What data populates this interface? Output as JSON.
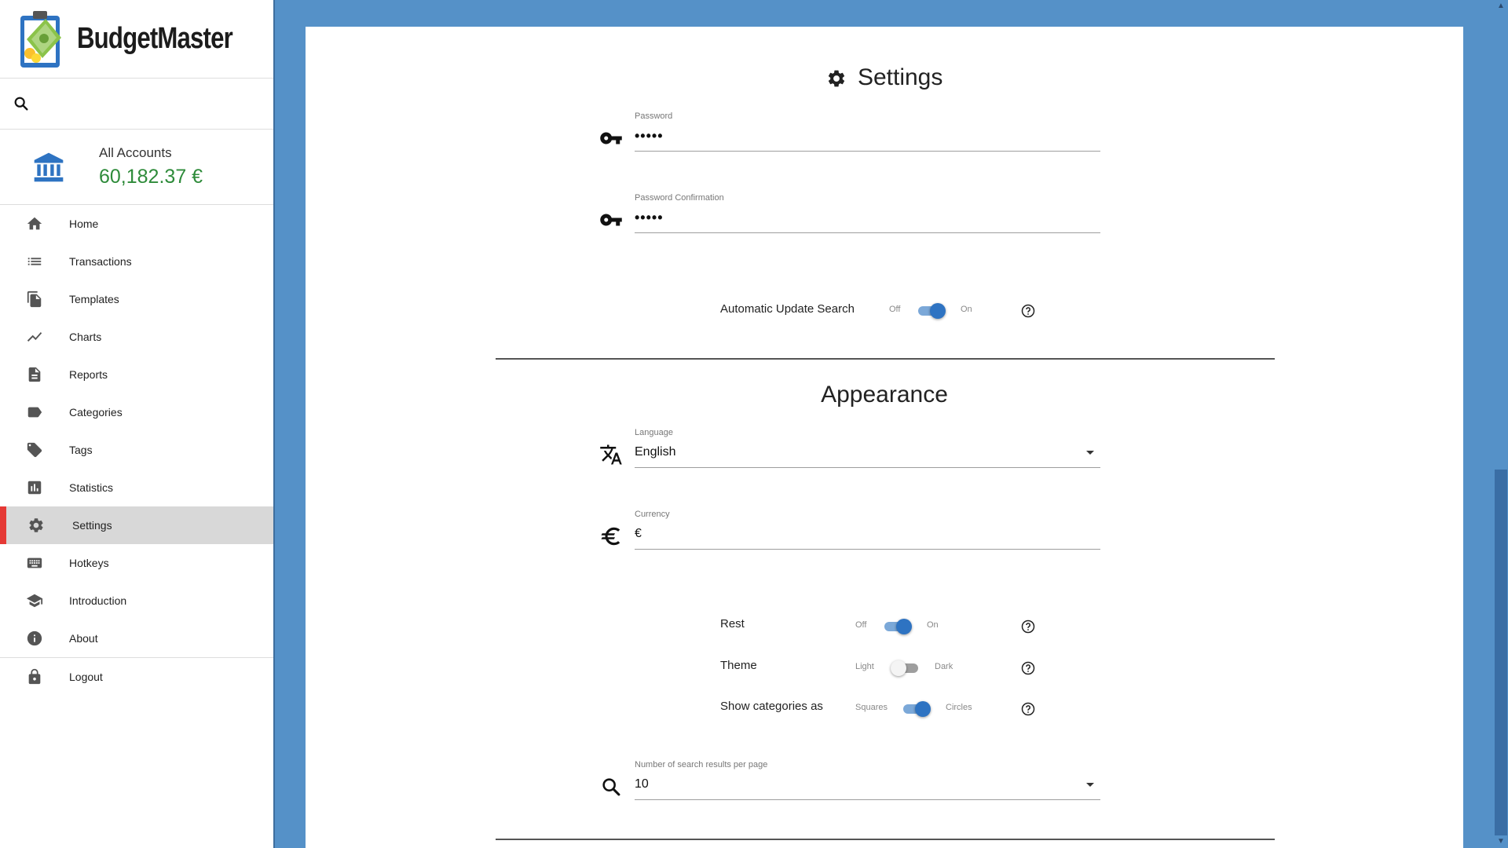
{
  "app": {
    "name": "BudgetMaster"
  },
  "sidebar": {
    "accounts_label": "All Accounts",
    "accounts_amount": "60,182.37 €",
    "items": [
      {
        "label": "Home",
        "icon": "home-icon"
      },
      {
        "label": "Transactions",
        "icon": "list-icon"
      },
      {
        "label": "Templates",
        "icon": "file-copy-icon"
      },
      {
        "label": "Charts",
        "icon": "trending-icon"
      },
      {
        "label": "Reports",
        "icon": "document-icon"
      },
      {
        "label": "Categories",
        "icon": "label-icon"
      },
      {
        "label": "Tags",
        "icon": "tag-icon"
      },
      {
        "label": "Statistics",
        "icon": "bar-chart-icon"
      },
      {
        "label": "Settings",
        "icon": "gear-icon",
        "active": true
      },
      {
        "label": "Hotkeys",
        "icon": "keyboard-icon"
      },
      {
        "label": "Introduction",
        "icon": "school-icon"
      },
      {
        "label": "About",
        "icon": "info-icon"
      },
      {
        "label": "Logout",
        "icon": "lock-icon"
      }
    ]
  },
  "settings": {
    "title": "Settings",
    "password_label": "Password",
    "password_value": "•••••",
    "password_confirm_label": "Password Confirmation",
    "password_confirm_value": "•••••",
    "auto_update": {
      "label": "Automatic Update Search",
      "off": "Off",
      "on": "On",
      "state": "on"
    }
  },
  "appearance": {
    "title": "Appearance",
    "language_label": "Language",
    "language_value": "English",
    "currency_label": "Currency",
    "currency_value": "€",
    "rest": {
      "label": "Rest",
      "off": "Off",
      "on": "On",
      "state": "on"
    },
    "theme": {
      "label": "Theme",
      "off": "Light",
      "on": "Dark",
      "state": "off"
    },
    "categories": {
      "label": "Show categories as",
      "off": "Squares",
      "on": "Circles",
      "state": "on"
    },
    "search_results_label": "Number of search results per page",
    "search_results_value": "10"
  },
  "colors": {
    "accent": "#2e73c2",
    "background": "#5591c8",
    "active_marker": "#e53935",
    "amount_green": "#2e8b3a"
  }
}
